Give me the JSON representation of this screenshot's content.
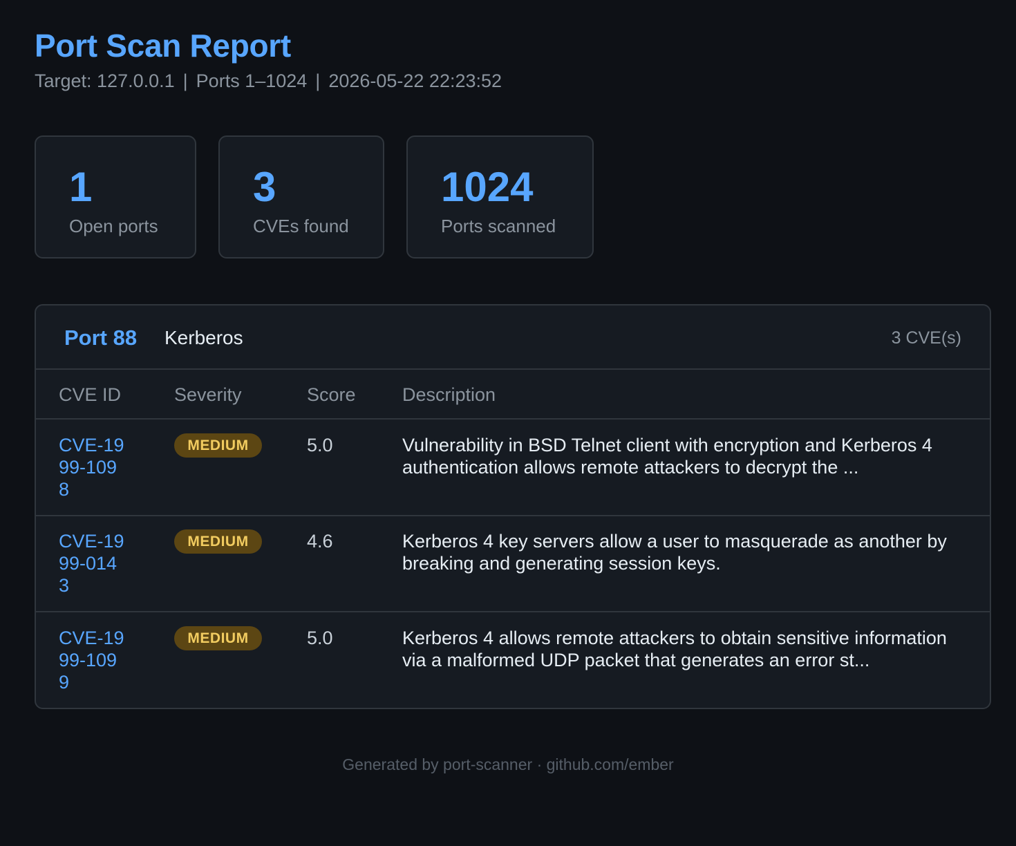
{
  "report": {
    "title": "Port Scan Report",
    "target": "Target: 127.0.0.1",
    "ports_range": "Ports 1–1024",
    "timestamp": "2026-05-22 22:23:52",
    "separator": "|"
  },
  "stats": [
    {
      "value": "1",
      "label": "Open ports"
    },
    {
      "value": "3",
      "label": "CVEs found"
    },
    {
      "value": "1024",
      "label": "Ports scanned"
    }
  ],
  "port": {
    "number": "Port 88",
    "service": "Kerberos",
    "cve_count": "3 CVE(s)"
  },
  "table": {
    "headers": [
      "CVE ID",
      "Severity",
      "Score",
      "Description"
    ],
    "rows": [
      {
        "cve_id": "CVE-1999-1098",
        "severity": "MEDIUM",
        "score": "5.0",
        "description": "Vulnerability in BSD Telnet client with encryption and Kerberos 4 authentication allows remote attackers to decrypt the ..."
      },
      {
        "cve_id": "CVE-1999-0143",
        "severity": "MEDIUM",
        "score": "4.6",
        "description": "Kerberos 4 key servers allow a user to masquerade as another by breaking and generating session keys."
      },
      {
        "cve_id": "CVE-1999-1099",
        "severity": "MEDIUM",
        "score": "5.0",
        "description": "Kerberos 4 allows remote attackers to obtain sensitive information via a malformed UDP packet that generates an error st..."
      }
    ]
  },
  "footer": {
    "text": "Generated by port-scanner · github.com/ember"
  },
  "colors": {
    "background": "#0e1116",
    "panel": "#161b22",
    "border": "#30363d",
    "accent": "#58a6ff",
    "medium_badge_bg": "#5c4613",
    "medium_badge_text": "#f2cc60"
  }
}
